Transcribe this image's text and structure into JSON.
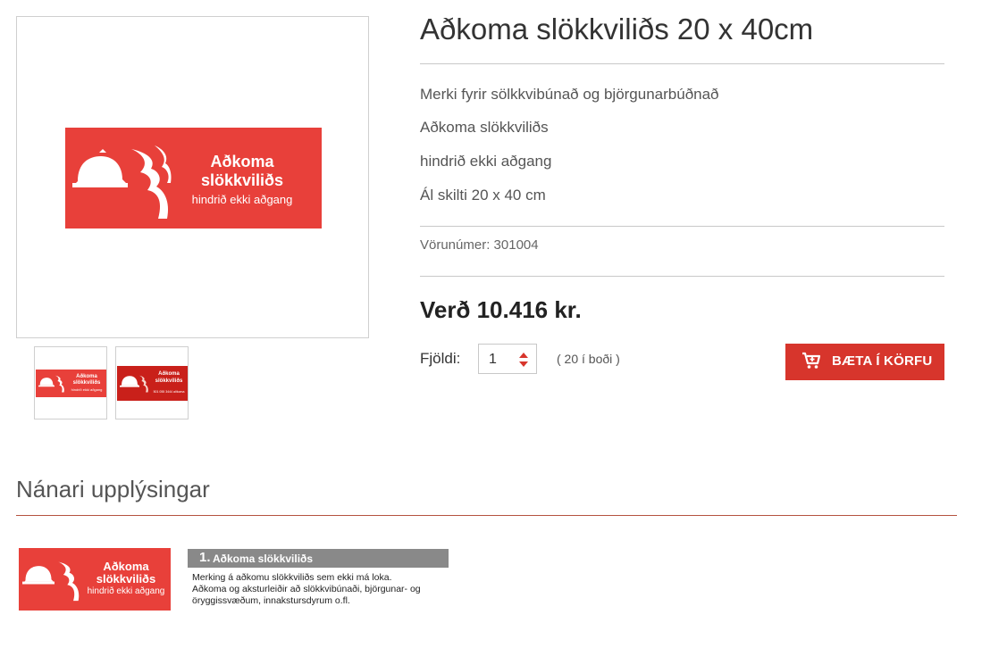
{
  "product": {
    "title": "Aðkoma slökkviliðs 20 x 40cm",
    "description_lines": [
      "Merki fyrir sölkkvibúnað og björgunarbúðnað",
      "Aðkoma slökkviliðs",
      "hindrið ekki aðgang",
      "Ál skilti  20 x 40 cm"
    ],
    "sku": "Vörunúmer: 301004",
    "price": "Verð 10.416 kr.",
    "quantity_label": "Fjöldi:",
    "quantity_value": "1",
    "availability": "( 20 í boði )",
    "add_to_cart_label": "BÆTA Í KÖRFU"
  },
  "sign_image": {
    "line1": "Aðkoma",
    "line2": "slökkviliðs",
    "line3": "hindrið ekki aðgang",
    "color": "#e8403a"
  },
  "thumbnails": [
    {
      "line1": "Aðkoma",
      "line2": "slökkviliðs",
      "line3": "hindrið ekki aðgang"
    },
    {
      "line1": "Aðkoma",
      "line2": "slökkviliðs",
      "line3": "501 055 3444 aðkoma"
    }
  ],
  "details": {
    "heading": "Nánari upplýsingar",
    "info_number": "1.",
    "info_title": "Aðkoma slökkviliðs",
    "info_lines": [
      "Merking á aðkomu slökkviliðs sem ekki má loka.",
      "Aðkoma og aksturleiðir að slökkvibúnaði, björgunar- og",
      "öryggissvæðum, innakstursdyrum o.fl."
    ]
  },
  "colors": {
    "accent": "#d7352c",
    "divider": "#c8c8c8",
    "section_line": "#b5523f"
  }
}
